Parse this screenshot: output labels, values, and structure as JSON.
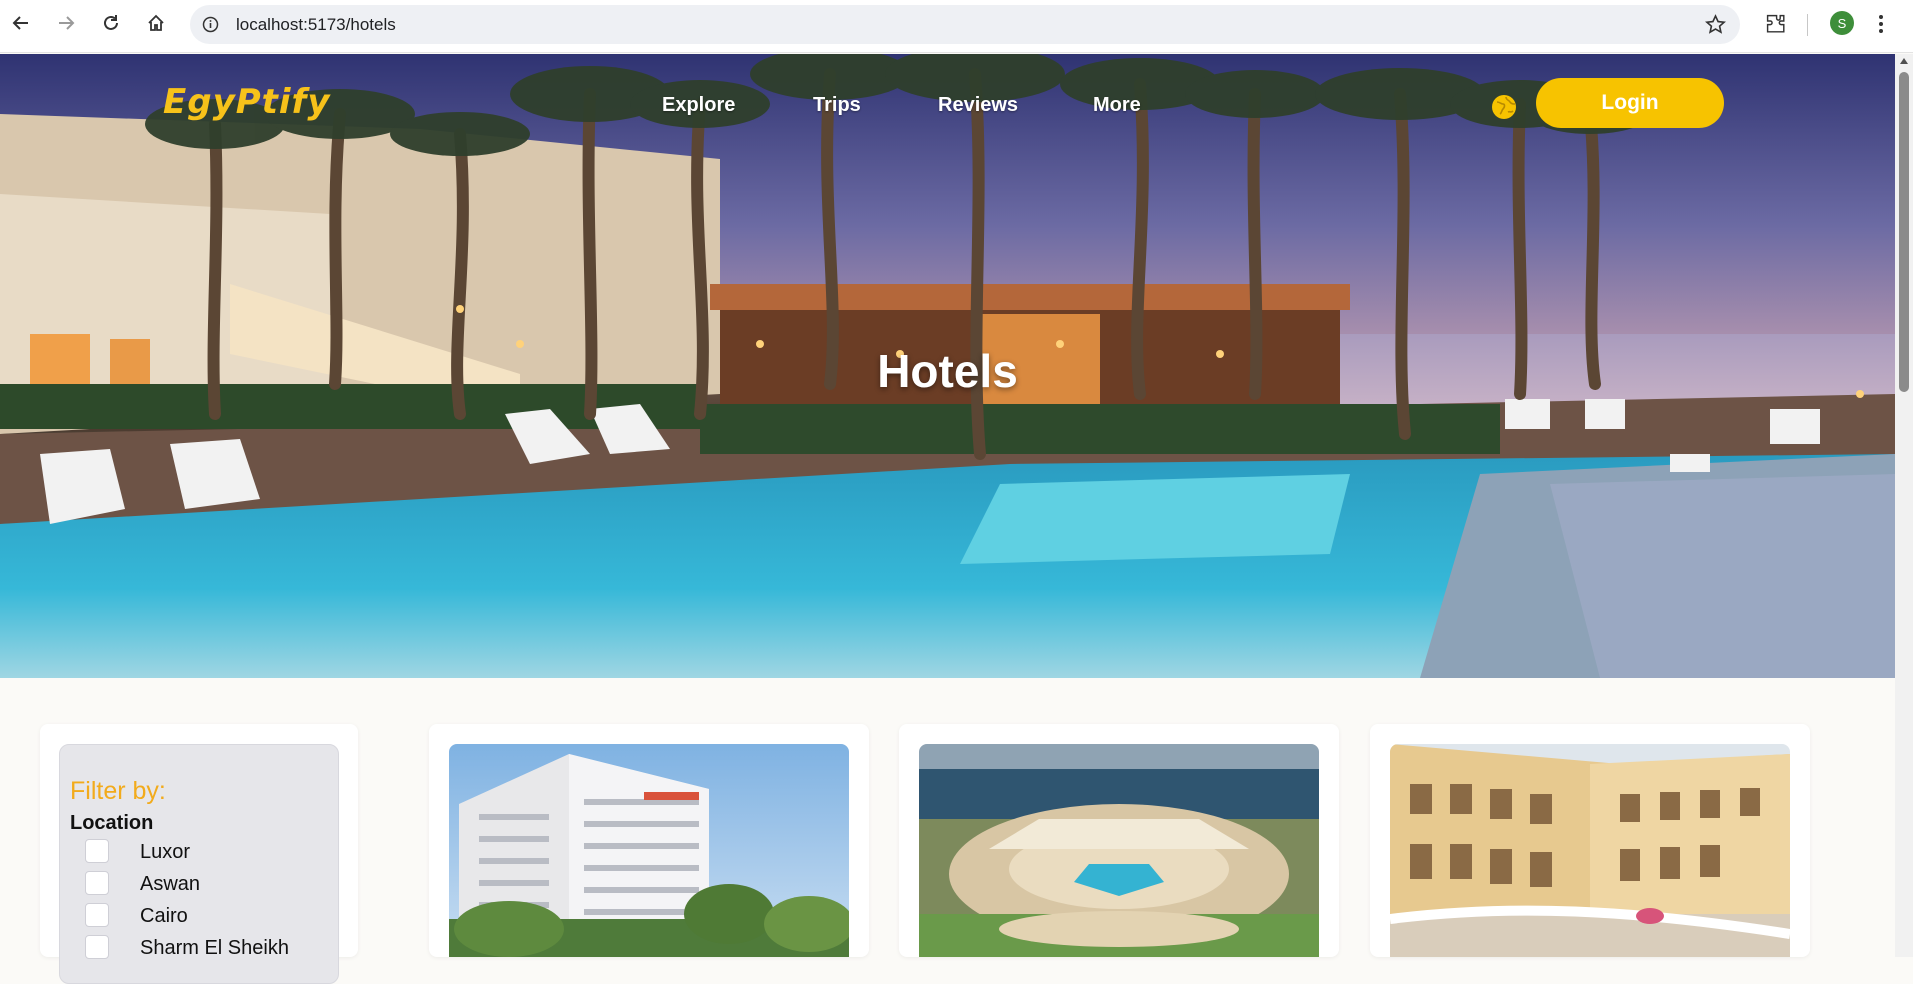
{
  "browser": {
    "url": "localhost:5173/hotels",
    "profile_initial": "S",
    "icons": [
      "back-icon",
      "forward-icon",
      "reload-icon",
      "home-icon",
      "site-info-icon",
      "bookmark-star-icon",
      "extensions-icon",
      "kebab-menu-icon"
    ]
  },
  "header": {
    "logo_text": "EgyPtify",
    "nav": [
      "Explore",
      "Trips",
      "Reviews",
      "More"
    ],
    "language_icon": "globe-icon",
    "login_label": "Login"
  },
  "hero": {
    "title": "Hotels"
  },
  "filter": {
    "title": "Filter by:",
    "group_label": "Location",
    "options": [
      "Luxor",
      "Aswan",
      "Cairo",
      "Sharm El Sheikh"
    ]
  },
  "hotels": [
    {
      "image": "hotel-tower-photo"
    },
    {
      "image": "hotel-resort-pool-photo"
    },
    {
      "image": "hotel-palace-photo"
    }
  ],
  "colors": {
    "accent": "#f7c300",
    "filter_title": "#f2ab1c",
    "page_bg": "#fbfaf7"
  }
}
